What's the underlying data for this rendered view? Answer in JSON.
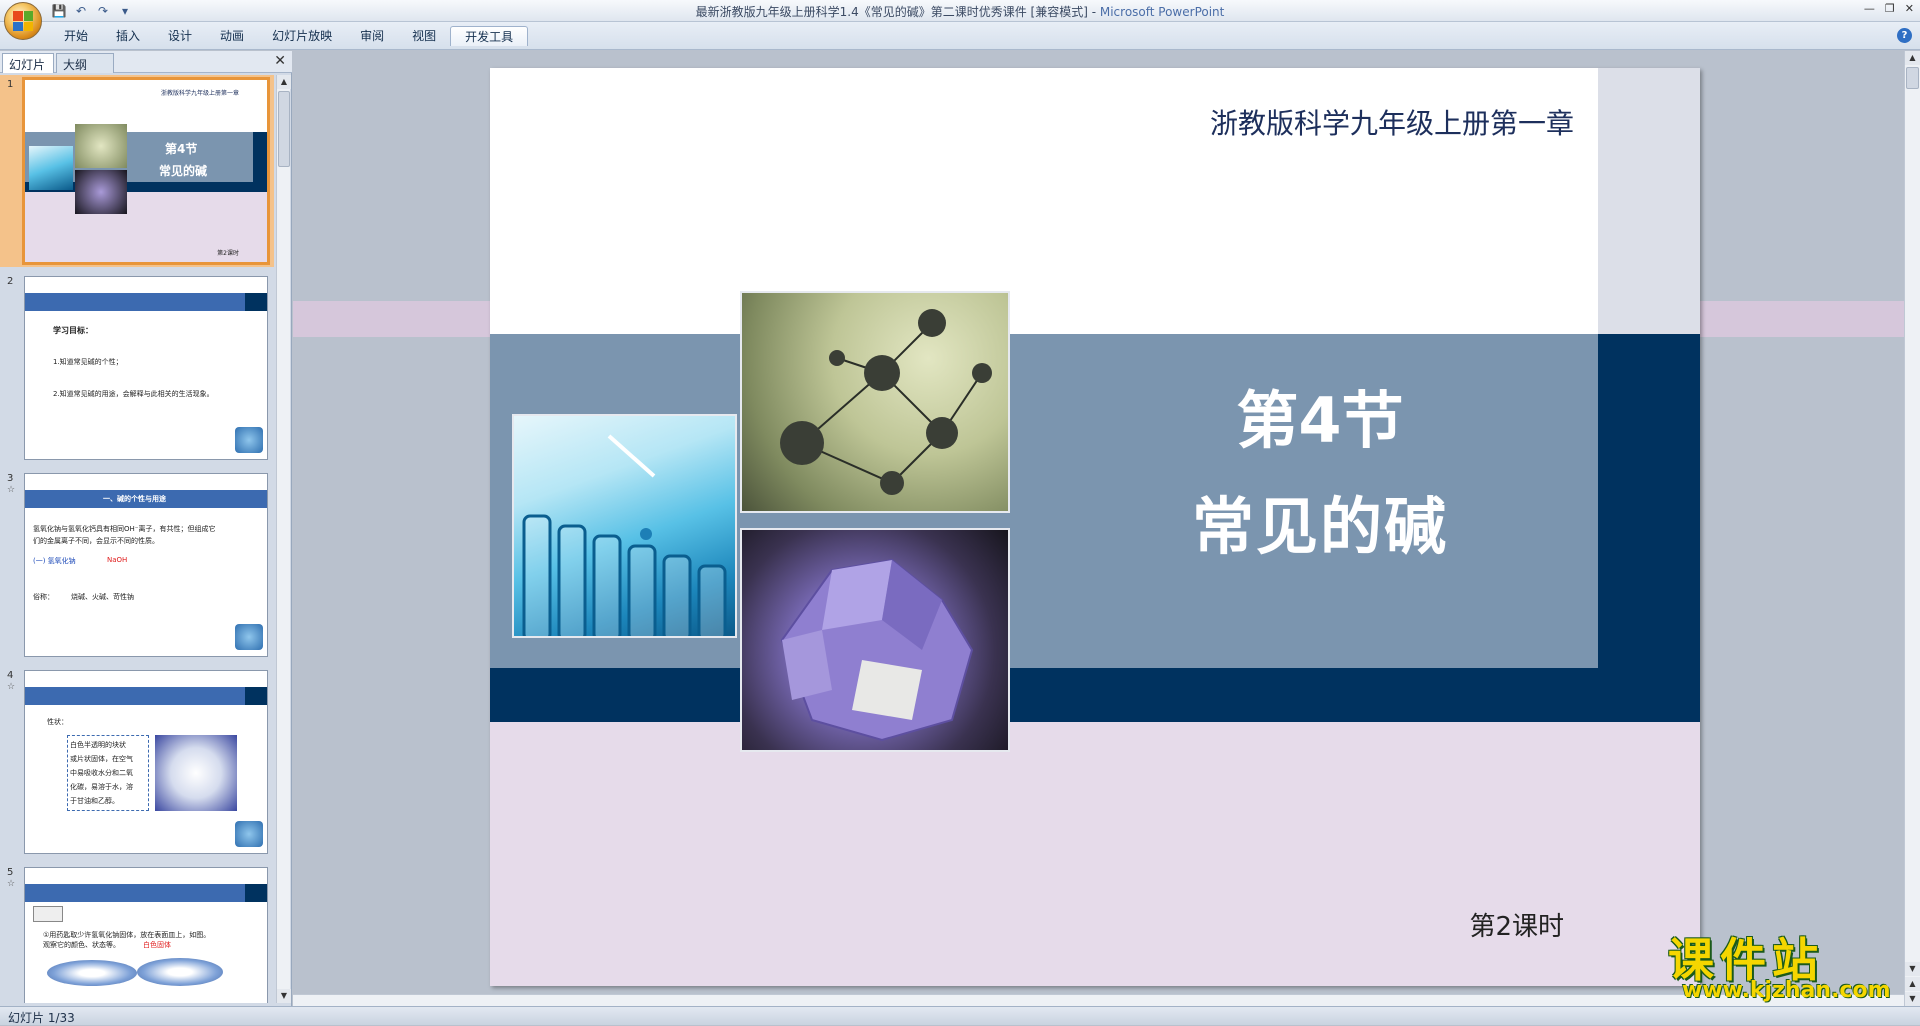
{
  "window": {
    "title": "最新浙教版九年级上册科学1.4《常见的碱》第二课时优秀课件 [兼容模式]",
    "app_name": "Microsoft PowerPoint",
    "separator": " - "
  },
  "ribbon": {
    "tabs": [
      "开始",
      "插入",
      "设计",
      "动画",
      "幻灯片放映",
      "审阅",
      "视图",
      "开发工具"
    ],
    "active_tab": "开发工具"
  },
  "panel": {
    "tab_slides": "幻灯片",
    "tab_outline": "大纲"
  },
  "thumbnails": [
    {
      "num": "1",
      "lines": [
        "浙教版科学九年级上册第一章",
        "第4节",
        "常见的碱",
        "第2课时"
      ]
    },
    {
      "num": "2",
      "lines": [
        "学习目标：",
        "1.知道常见碱的个性；",
        "2.知道常见碱的用途，会解释与此相关的生活现象。"
      ]
    },
    {
      "num": "3",
      "lines": [
        "一、碱的个性与用途",
        "氢氧化钠与氢氧化钙具有相同OH⁻离子，有共性；但组成它",
        "们的金属离子不同，会显示不同的性质。",
        "(一) 氢氧化钠",
        "NaOH",
        "俗称：",
        "烧碱、火碱、苛性钠"
      ]
    },
    {
      "num": "4",
      "lines": [
        "性状：",
        "白色半透明的块状",
        "或片状固体，在空气",
        "中易吸收水分和二氧",
        "化碳，易溶于水，溶",
        "于甘油和乙醇。"
      ]
    },
    {
      "num": "5",
      "lines": [
        "①用药匙取少许氢氧化钠固体，放在表面皿上，如图。",
        "观察它的颜色、状态等。",
        "白色固体"
      ]
    }
  ],
  "slide": {
    "subtitle": "浙教版科学九年级上册第一章",
    "title_line1": "第4节",
    "title_line2": "常见的碱",
    "lesson": "第2课时"
  },
  "status": {
    "slide_counter": "幻灯片 1/33"
  },
  "watermark": {
    "big": "课件站",
    "small": "www.kjzhan.com"
  },
  "colors": {
    "navy": "#00325f",
    "steel_blue": "#7b95af",
    "pink": "#e6dbea",
    "selected_border": "#e8953a"
  }
}
